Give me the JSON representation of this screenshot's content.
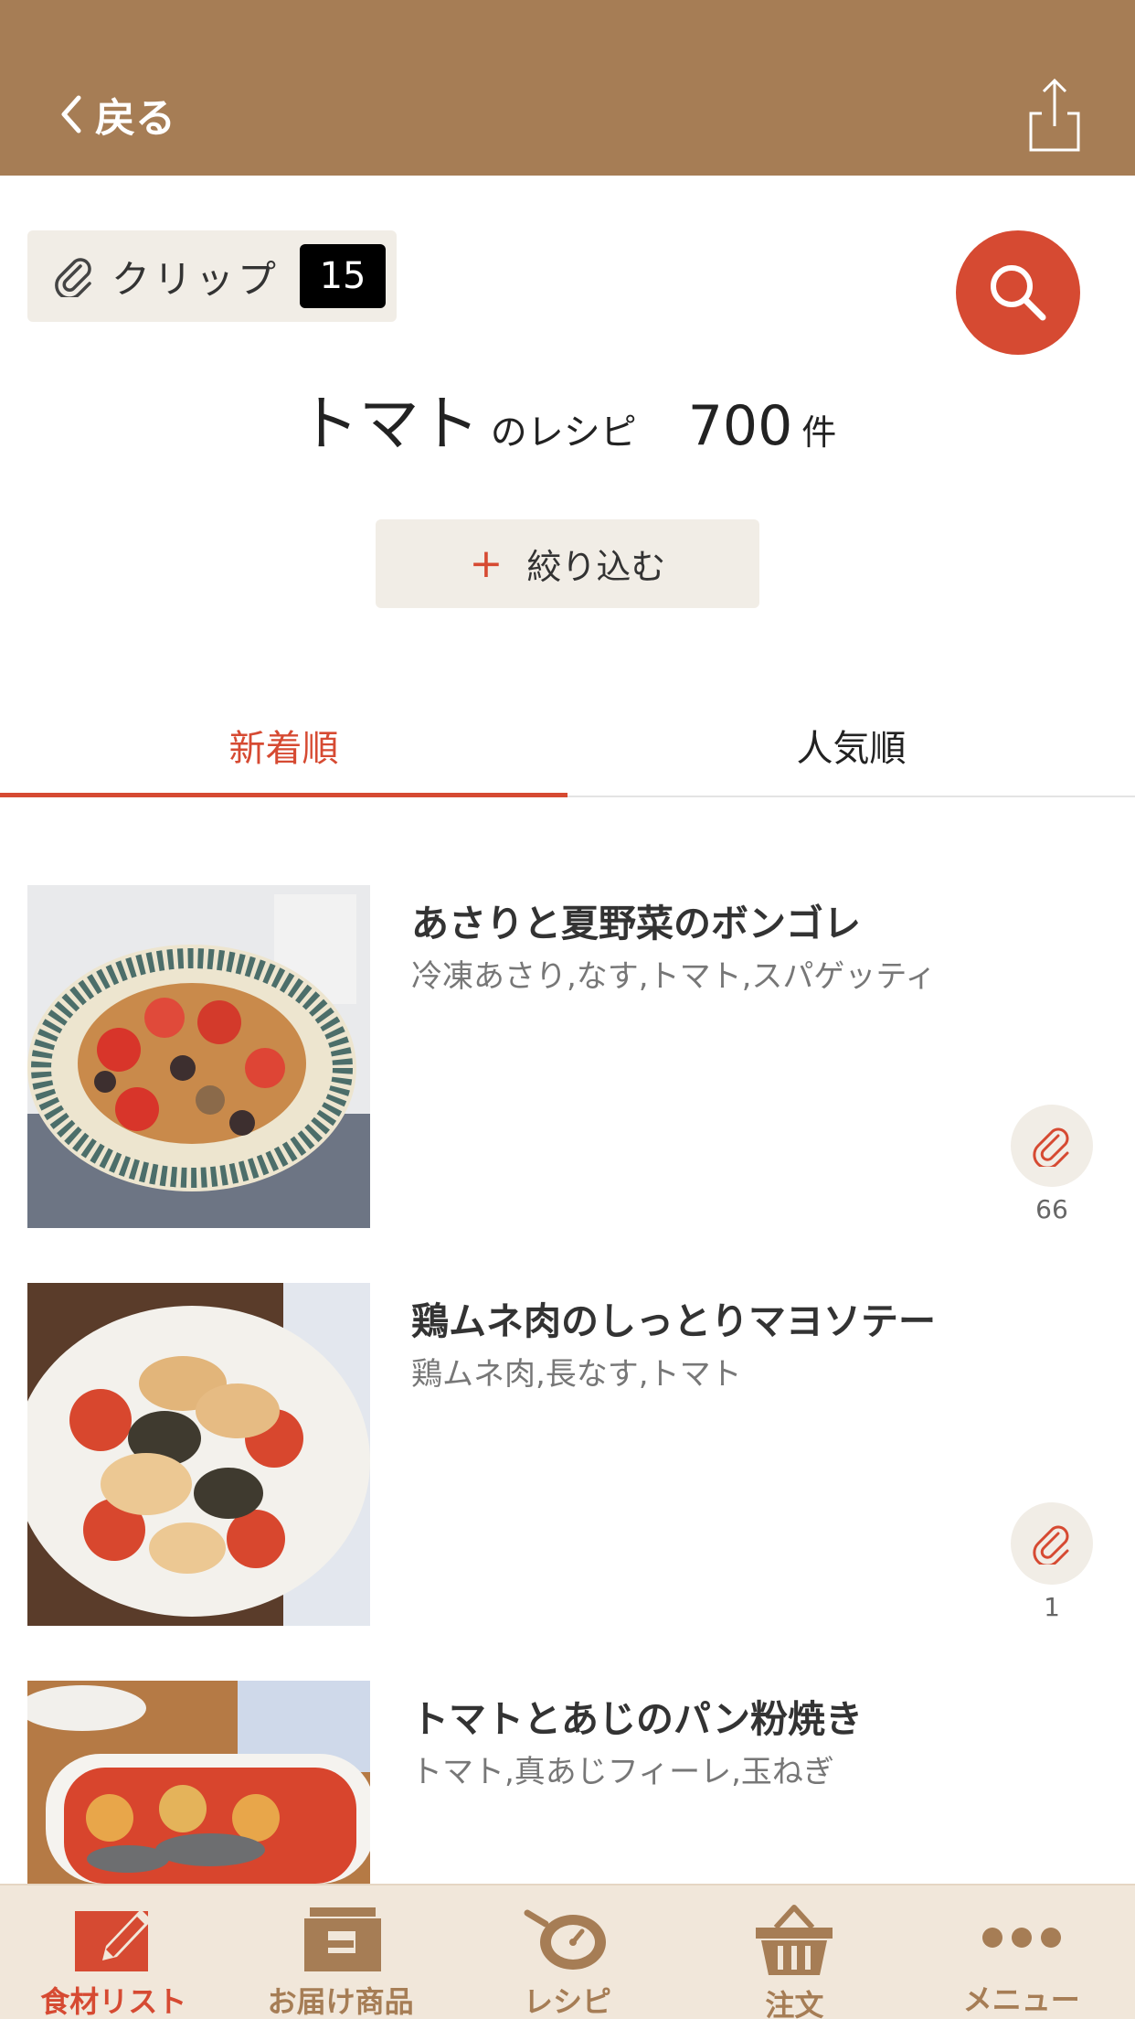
{
  "header": {
    "back_label": "戻る"
  },
  "clip": {
    "label": "クリップ",
    "count": "15"
  },
  "result": {
    "keyword": "トマト",
    "suffix": "のレシピ",
    "count": "700",
    "unit": "件"
  },
  "filter": {
    "plus": "+",
    "label": "絞り込む"
  },
  "tabs": [
    {
      "label": "新着順",
      "active": true
    },
    {
      "label": "人気順",
      "active": false
    }
  ],
  "recipes": [
    {
      "title": "あさりと夏野菜のボンゴレ",
      "ingredients": "冷凍あさり,なす,トマト,スパゲッティ",
      "clips": "66"
    },
    {
      "title": "鶏ムネ肉のしっとりマヨソテー",
      "ingredients": "鶏ムネ肉,長なす,トマト",
      "clips": "1"
    },
    {
      "title": "トマトとあじのパン粉焼き",
      "ingredients": "トマト,真あじフィーレ,玉ねぎ",
      "clips": ""
    }
  ],
  "tabbar": [
    {
      "label": "食材リスト",
      "icon": "pencil-list-icon",
      "active": true
    },
    {
      "label": "お届け商品",
      "icon": "delivery-box-icon",
      "active": false
    },
    {
      "label": "レシピ",
      "icon": "recipe-pot-icon",
      "active": false
    },
    {
      "label": "注文",
      "icon": "basket-icon",
      "active": false
    },
    {
      "label": "メニュー",
      "icon": "more-dots-icon",
      "active": false
    }
  ],
  "colors": {
    "header": "#a67d55",
    "accent": "#d64a32",
    "pill_bg": "#f1ede6",
    "tabbar_bg": "#f1e7da"
  }
}
